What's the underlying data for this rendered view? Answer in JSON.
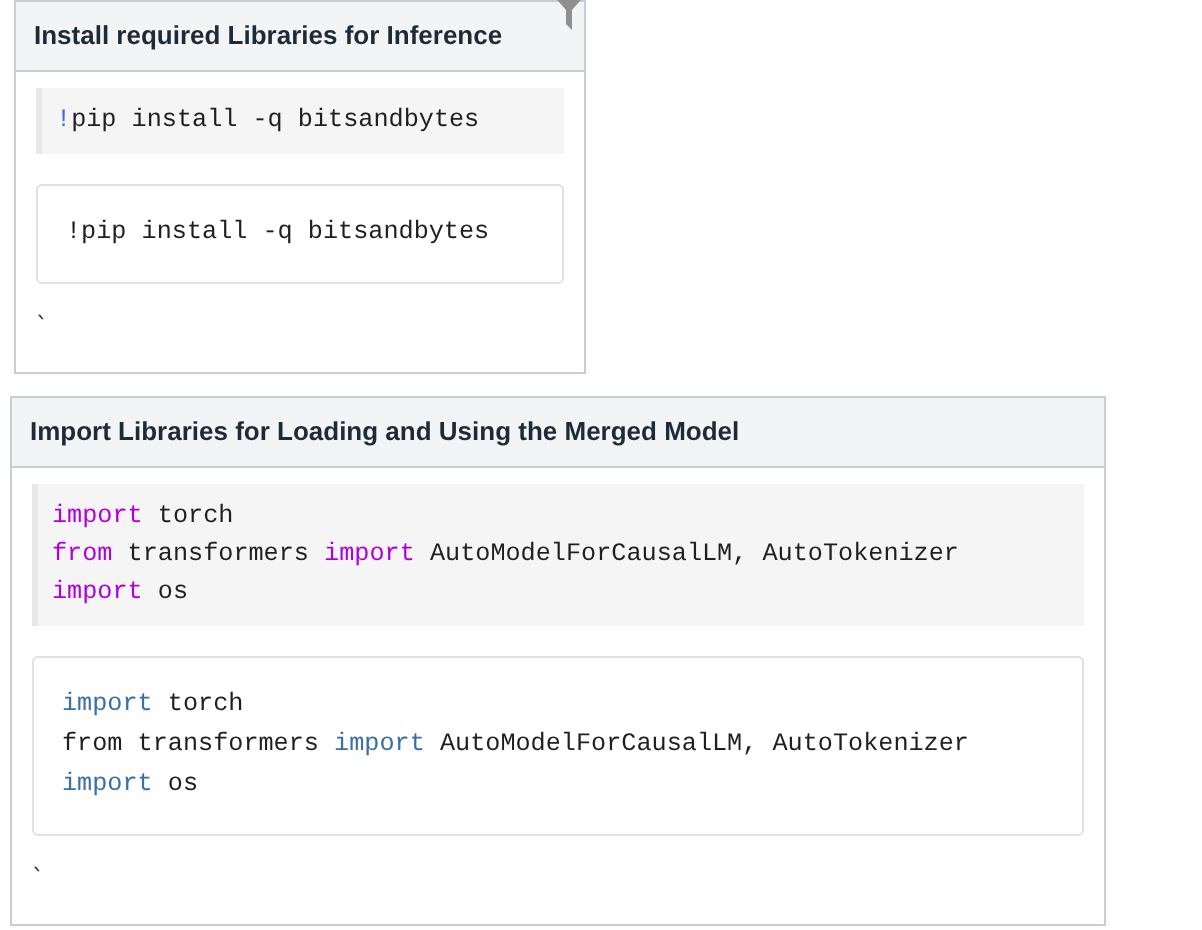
{
  "cells": [
    {
      "title": "Install required Libraries for Inference",
      "filter_icon": true,
      "blocks": [
        {
          "kind": "source",
          "lines": [
            [
              {
                "text": "!",
                "kind": "operator"
              },
              {
                "text": "pip install -q bitsandbytes",
                "kind": "text"
              }
            ]
          ]
        },
        {
          "kind": "output",
          "lines": [
            [
              {
                "text": "!pip install -q bitsandbytes",
                "kind": "text"
              }
            ]
          ]
        }
      ],
      "note": "`"
    },
    {
      "title": "Import Libraries for Loading and Using the Merged Model",
      "filter_icon": false,
      "blocks": [
        {
          "kind": "source",
          "lines": [
            [
              {
                "text": "import",
                "kind": "keyword"
              },
              {
                "text": " torch",
                "kind": "text"
              }
            ],
            [
              {
                "text": "from",
                "kind": "keyword"
              },
              {
                "text": " transformers ",
                "kind": "text"
              },
              {
                "text": "import",
                "kind": "keyword"
              },
              {
                "text": " AutoModelForCausalLM, AutoTokenizer",
                "kind": "text"
              }
            ],
            [
              {
                "text": "import",
                "kind": "keyword"
              },
              {
                "text": " os",
                "kind": "text"
              }
            ]
          ]
        },
        {
          "kind": "output",
          "lines": [
            [
              {
                "text": "import",
                "kind": "keyword"
              },
              {
                "text": " torch",
                "kind": "text"
              }
            ],
            [
              {
                "text": "from transformers ",
                "kind": "text"
              },
              {
                "text": "import",
                "kind": "keyword"
              },
              {
                "text": " AutoModelForCausalLM, AutoTokenizer",
                "kind": "text"
              }
            ],
            [
              {
                "text": "import",
                "kind": "keyword"
              },
              {
                "text": " os",
                "kind": "text"
              }
            ]
          ]
        }
      ],
      "note": "`"
    }
  ]
}
